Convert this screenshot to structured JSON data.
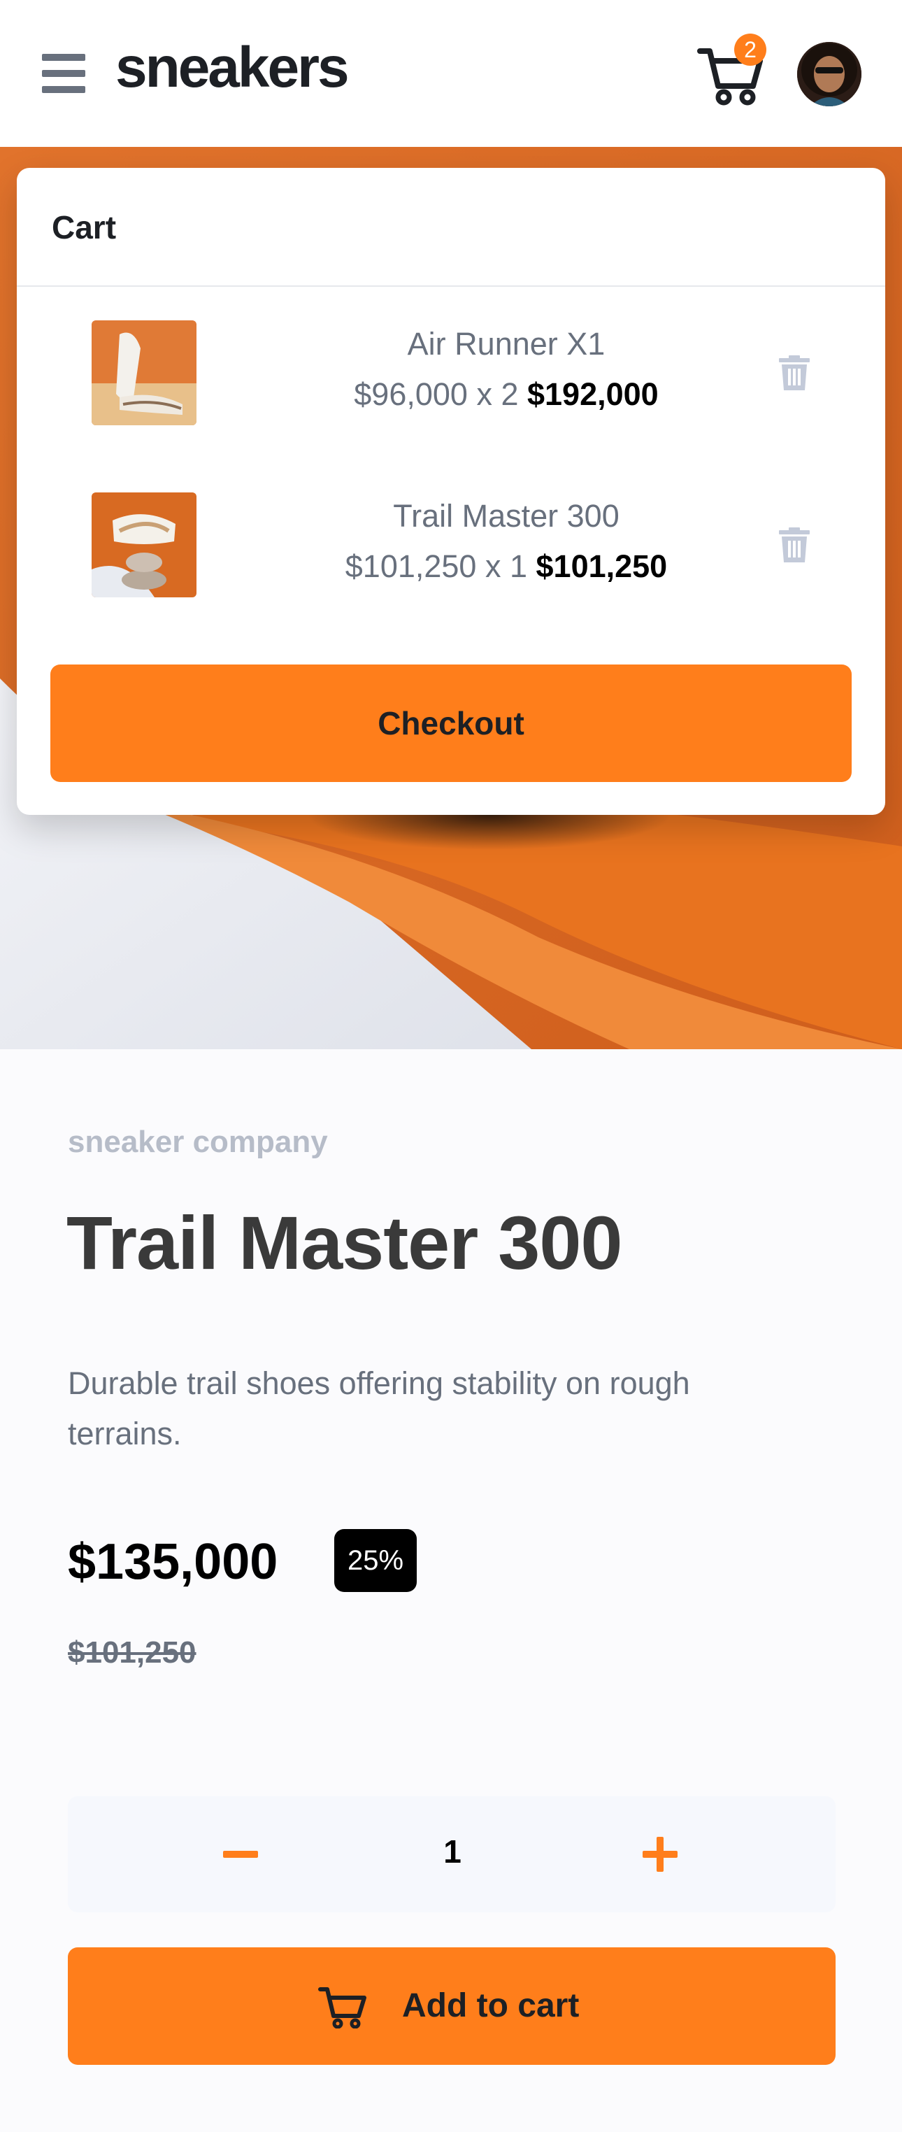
{
  "header": {
    "logo": "sneakers",
    "cart_count": "2"
  },
  "cart": {
    "title": "Cart",
    "items": [
      {
        "name": "Air Runner X1",
        "unit_price": "$96,000",
        "qty_text": " x 2 ",
        "total": "$192,000"
      },
      {
        "name": "Trail Master 300",
        "unit_price": "$101,250",
        "qty_text": " x 1 ",
        "total": "$101,250"
      }
    ],
    "checkout_label": "Checkout"
  },
  "product": {
    "company": "sneaker company",
    "title": "Trail Master 300",
    "description": "Durable trail shoes offering stability on rough terrains.",
    "price": "$135,000",
    "discount": "25%",
    "original_price": "$101,250"
  },
  "quantity": {
    "value": "1"
  },
  "add_to_cart_label": "Add to cart",
  "colors": {
    "accent": "#ff7e1b",
    "dark": "#1d2025",
    "muted": "#68707d"
  }
}
